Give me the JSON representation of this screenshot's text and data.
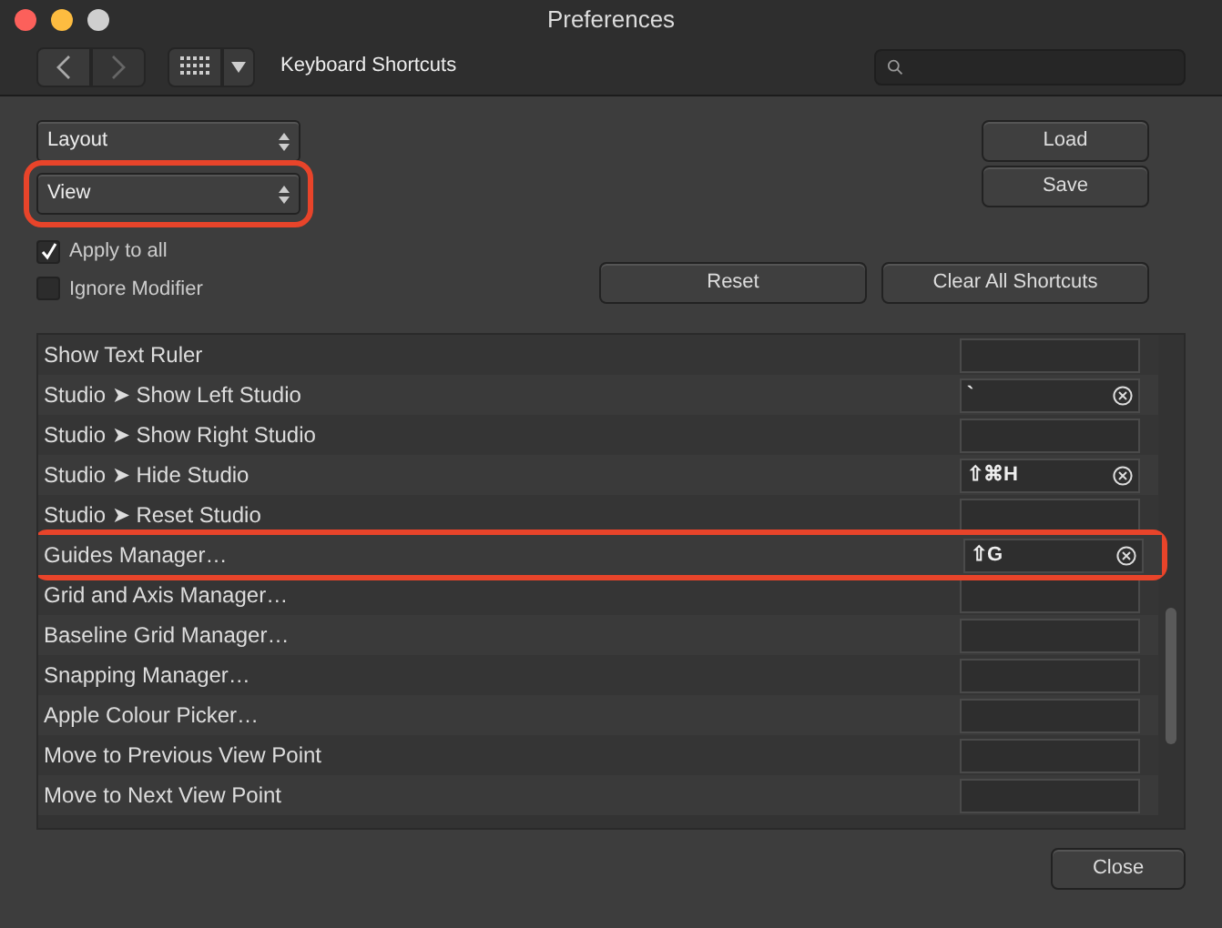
{
  "window": {
    "title": "Preferences"
  },
  "toolbar": {
    "section_title": "Keyboard Shortcuts"
  },
  "dropdowns": [
    {
      "value": "Layout",
      "highlighted": false
    },
    {
      "value": "View",
      "highlighted": true
    }
  ],
  "side_buttons": [
    "Load",
    "Save"
  ],
  "checkboxes": [
    {
      "label": "Apply to all",
      "checked": true
    },
    {
      "label": "Ignore Modifier",
      "checked": false
    }
  ],
  "action_buttons": [
    "Reset",
    "Clear All Shortcuts"
  ],
  "shortcuts": [
    {
      "name": "Show Text Ruler",
      "highlighted": false
    },
    {
      "name": "Studio ➤ Show Left Studio",
      "shortcut": "`",
      "highlighted": false
    },
    {
      "name": "Studio ➤ Show Right Studio",
      "highlighted": false
    },
    {
      "name": "Studio ➤ Hide Studio",
      "shortcut": "⇧⌘H",
      "highlighted": false
    },
    {
      "name": "Studio ➤ Reset Studio",
      "highlighted": false
    },
    {
      "name": "Guides Manager…",
      "shortcut": "⇧G",
      "highlighted": true
    },
    {
      "name": "Grid and Axis Manager…",
      "highlighted": false
    },
    {
      "name": "Baseline Grid Manager…",
      "highlighted": false
    },
    {
      "name": "Snapping Manager…",
      "highlighted": false
    },
    {
      "name": "Apple Colour Picker…",
      "highlighted": false
    },
    {
      "name": "Move to Previous View Point",
      "highlighted": false
    },
    {
      "name": "Move to Next View Point",
      "highlighted": false
    }
  ],
  "footer_button": "Close"
}
